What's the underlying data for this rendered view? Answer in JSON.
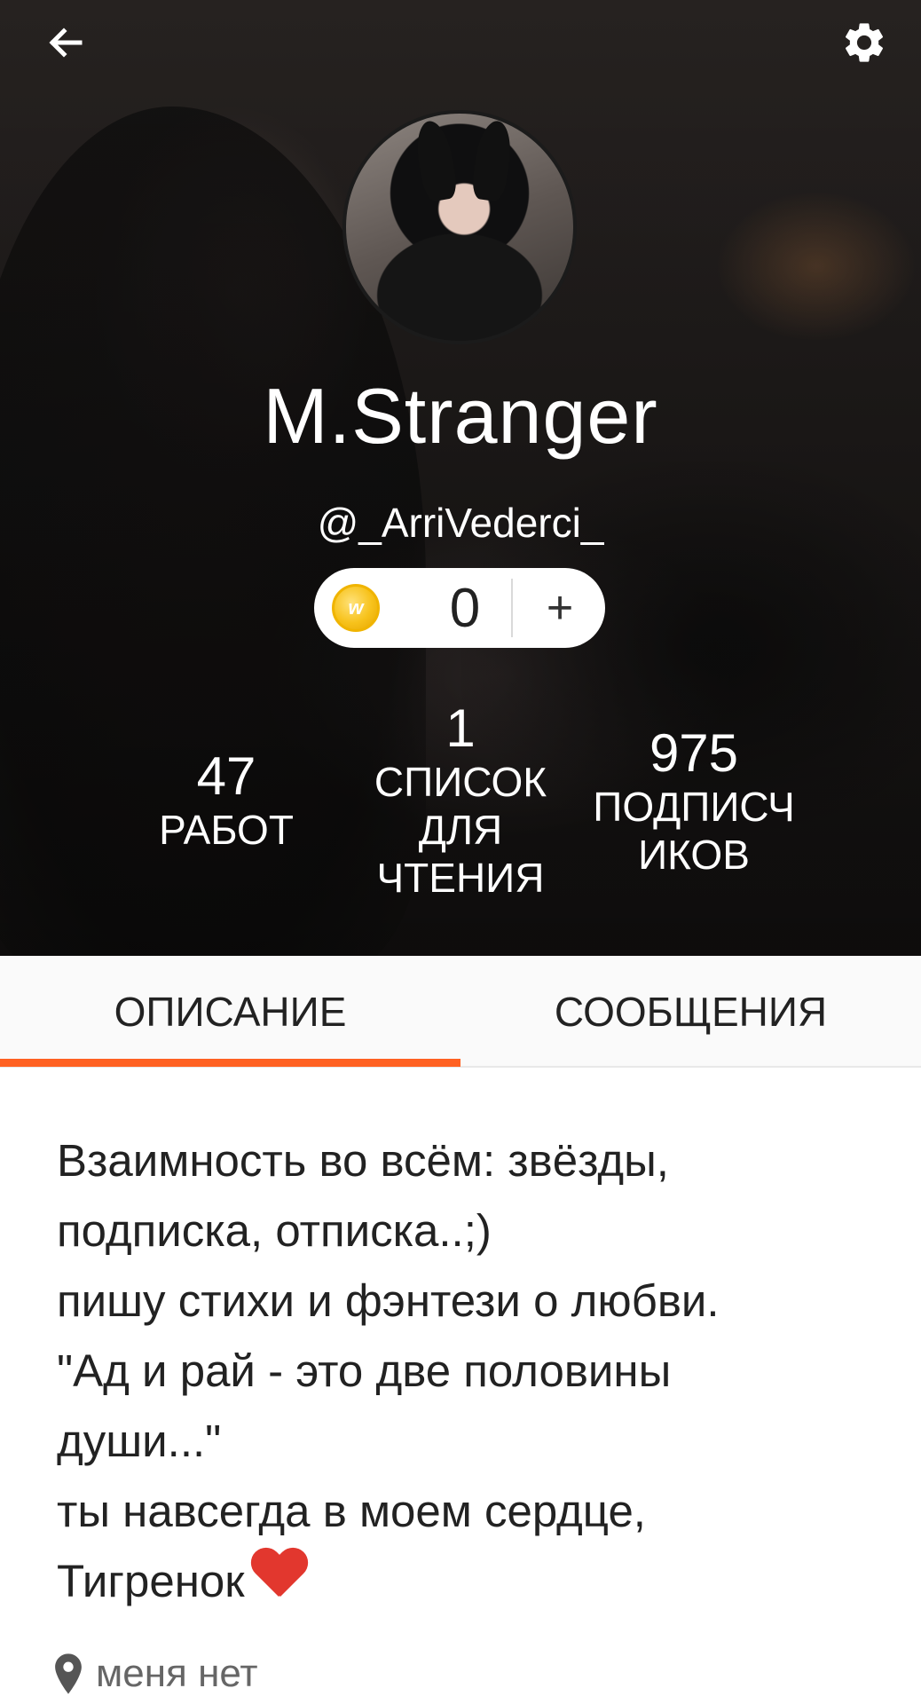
{
  "profile": {
    "display_name": "M.Stranger",
    "username": "@_ArriVederci_"
  },
  "icons": {
    "back": "arrow-left-icon",
    "settings": "gear-icon",
    "coin": "wattpad-coin-icon",
    "location": "location-pin-icon",
    "heart": "red-heart-emoji"
  },
  "coins": {
    "count": "0",
    "add_label": "+"
  },
  "stats": {
    "works": {
      "value": "47",
      "label": "РАБОТ"
    },
    "reading_lists": {
      "value": "1",
      "label_lines": [
        "СПИСОК",
        "ДЛЯ",
        "ЧТЕНИЯ"
      ]
    },
    "followers": {
      "value": "975",
      "label_lines": [
        "ПОДПИСЧ",
        "ИКОВ"
      ]
    }
  },
  "tabs": {
    "about": "ОПИСАНИЕ",
    "messages": "СООБЩЕНИЯ",
    "active": "about"
  },
  "about": {
    "lines": [
      "Взаимность во всём: звёзды,",
      "подписка, отписка..;)",
      "пишу стихи и фэнтези о любви.",
      "\"Ад и рай - это две половины",
      "души...\"",
      "ты навсегда в моем сердце,",
      "Тигренок"
    ],
    "location": "меня нет"
  },
  "colors": {
    "accent": "#ff6122",
    "heart": "#e2372e",
    "coin": "#f7c21b"
  }
}
